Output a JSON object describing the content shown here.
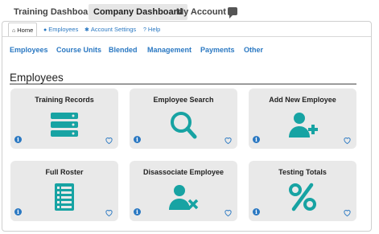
{
  "topnav": {
    "tabs": [
      {
        "label": "Training Dashboard"
      },
      {
        "label": "Company Dashboard"
      },
      {
        "label": "My Account"
      }
    ],
    "chat_icon": "chat-icon"
  },
  "subnav": {
    "tabs": [
      {
        "label": "Home",
        "icon": "home-icon"
      },
      {
        "label": "Employees",
        "icon": "users-icon"
      },
      {
        "label": "Account Settings",
        "icon": "gear-icon"
      },
      {
        "label": "Help",
        "icon": "question-icon"
      }
    ]
  },
  "categories": [
    "Employees",
    "Course Units",
    "Blended",
    "Management",
    "Payments",
    "Other"
  ],
  "section": {
    "title": "Employees"
  },
  "cards": [
    {
      "title": "Training Records",
      "icon": "server-stack-icon"
    },
    {
      "title": "Employee Search",
      "icon": "search-icon"
    },
    {
      "title": "Add New Employee",
      "icon": "user-plus-icon"
    },
    {
      "title": "Full Roster",
      "icon": "list-icon"
    },
    {
      "title": "Disassociate Employee",
      "icon": "user-remove-icon"
    },
    {
      "title": "Testing Totals",
      "icon": "percent-icon"
    }
  ],
  "card_info_glyph": "i",
  "colors": {
    "accent": "#17a3a3",
    "link": "#2a78c2",
    "card_bg": "#e9e9e9"
  }
}
